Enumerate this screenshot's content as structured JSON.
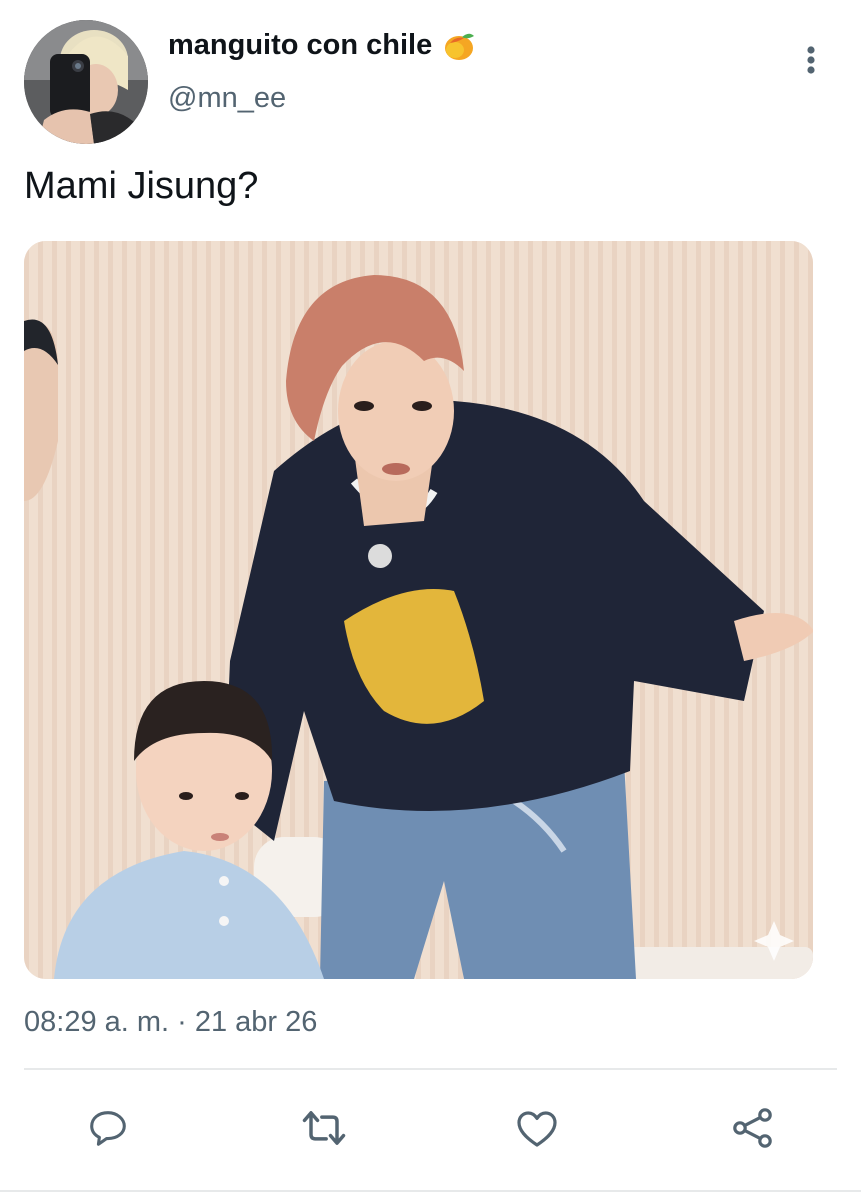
{
  "tweet": {
    "author_name": "manguito con chile",
    "author_emoji": "mango-emoji",
    "handle": "@mn_ee",
    "text": "Mami Jisung?",
    "timestamp": "08:29 a. m. · 21 abr 26"
  },
  "actions": [
    {
      "icon": "reply-icon"
    },
    {
      "icon": "retweet-icon"
    },
    {
      "icon": "like-icon"
    },
    {
      "icon": "share-icon"
    }
  ],
  "colors": {
    "text": "#0f1419",
    "secondary_text": "#536471",
    "icon": "#536471",
    "divider": "#e7e9ea"
  }
}
